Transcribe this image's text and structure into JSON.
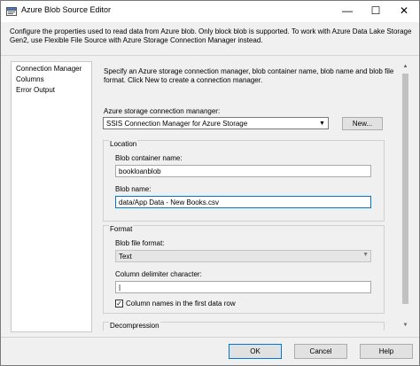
{
  "window": {
    "title": "Azure Blob Source Editor",
    "controls": {
      "minimize": "—",
      "maximize": "☐",
      "close": "✕"
    }
  },
  "description": "Configure the properties used to read data from Azure blob. Only block blob is supported. To work with Azure Data Lake Storage Gen2, use Flexible File Source with Azure Storage Connection Manager instead.",
  "nav": {
    "items": [
      "Connection Manager",
      "Columns",
      "Error Output"
    ]
  },
  "main": {
    "intro": "Specify an Azure storage connection manager, blob container name, blob name and blob file format. Click New to create a connection manager.",
    "connection_label": "Azure storage connection mananger:",
    "connection_value": "SSIS Connection Manager for Azure Storage",
    "new_button": "New...",
    "location": {
      "title": "Location",
      "container_label": "Blob container name:",
      "container_value": "bookloanblob",
      "blob_label": "Blob name:",
      "blob_value": "data/App Data - New Books.csv"
    },
    "format": {
      "title": "Format",
      "file_format_label": "Blob file format:",
      "file_format_value": "Text",
      "delimiter_label": "Column delimiter character:",
      "delimiter_value": "|",
      "column_names_label": "Column names in the first data row",
      "column_names_checked": true
    },
    "decompression_title": "Decompression"
  },
  "footer": {
    "ok": "OK",
    "cancel": "Cancel",
    "help": "Help"
  },
  "colors": {
    "accent": "#0078d7",
    "button_bg": "#e1e1e1",
    "window_bg": "#f0f0f0"
  }
}
